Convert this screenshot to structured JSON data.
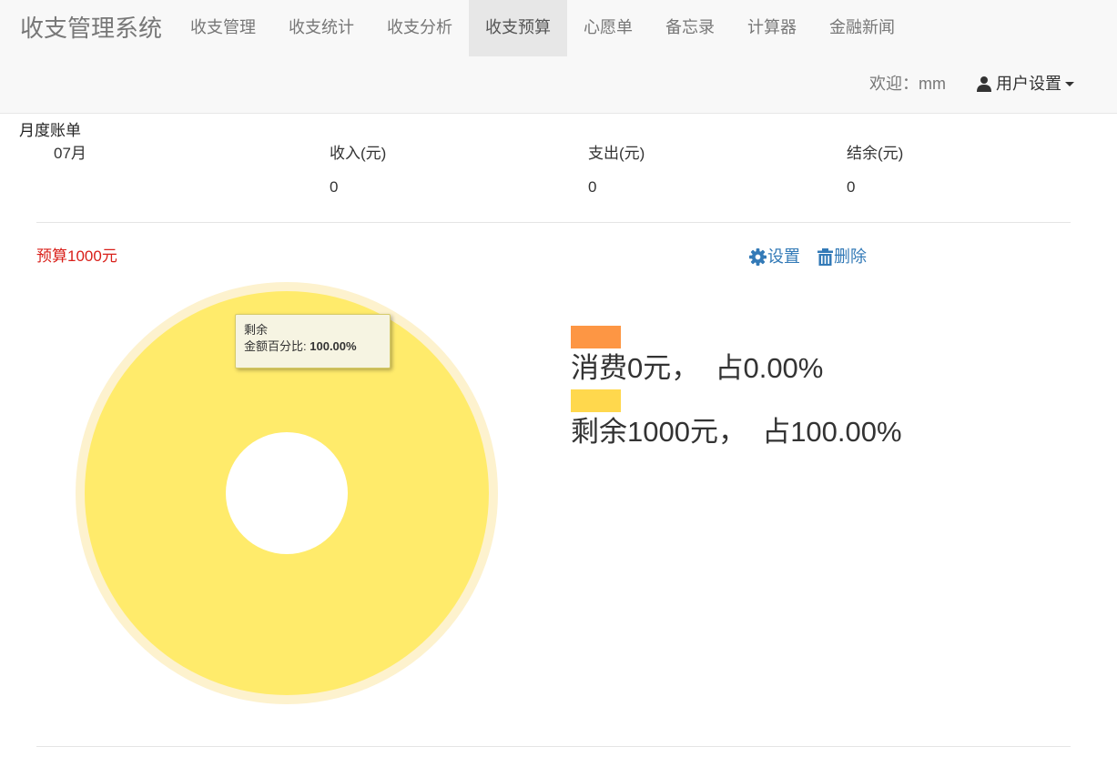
{
  "navbar": {
    "brand": "收支管理系统",
    "items": [
      "收支管理",
      "收支统计",
      "收支分析",
      "收支预算",
      "心愿单",
      "备忘录",
      "计算器",
      "金融新闻"
    ],
    "active_index": 3,
    "welcome": "欢迎：mm",
    "user_settings": "用户设置"
  },
  "bill": {
    "heading": "月度账单",
    "month": "07月",
    "income_label": "收入(元)",
    "expense_label": "支出(元)",
    "balance_label": "结余(元)",
    "income_value": "0",
    "expense_value": "0",
    "balance_value": "0"
  },
  "budget": {
    "title": "预算1000元",
    "settings_label": "设置",
    "delete_label": "删除"
  },
  "colors": {
    "consumed": "#fd9644",
    "remaining": "#ffd84d",
    "remaining_slice": "#ffeb6b",
    "budget_red": "#d9201a",
    "link": "#337ab7"
  },
  "chart_data": {
    "type": "pie",
    "series": [
      {
        "name": "消费",
        "amount": 0,
        "percent": 0.0
      },
      {
        "name": "剩余",
        "amount": 1000,
        "percent": 100.0
      }
    ],
    "tooltip": {
      "title": "剩余",
      "label": "金额百分比:",
      "value": "100.00%"
    },
    "legend": [
      {
        "text": "消费0元，  占0.00%"
      },
      {
        "text": "剩余1000元，  占100.00%"
      }
    ]
  }
}
